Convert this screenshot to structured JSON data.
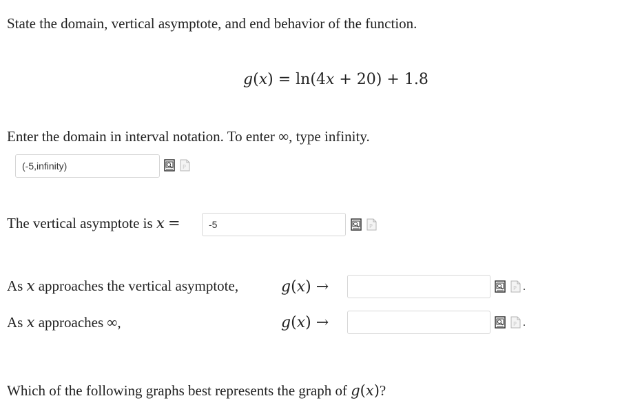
{
  "question": {
    "prompt": "State the domain, vertical asymptote, and end behavior of the function.",
    "function": {
      "lhs_name": "g",
      "lhs_var": "x",
      "rhs_ln": "ln",
      "rhs_inner_coef": "4",
      "rhs_inner_var": "x",
      "rhs_inner_const": "20",
      "rhs_add": "1.8"
    }
  },
  "domain_part": {
    "label": "Enter the domain in interval notation. To enter ∞, type infinity.",
    "value": "(-5,infinity)"
  },
  "asymptote_part": {
    "label_prefix": "The vertical asymptote is",
    "var": "x",
    "equals": "=",
    "value": "-5"
  },
  "end_behavior": {
    "row1_label_a": "As",
    "row1_var": "x",
    "row1_label_b": "approaches the vertical asymptote,",
    "row2_label_a": "As",
    "row2_var": "x",
    "row2_label_b": "approaches ∞,",
    "lhs": "g",
    "lhs_var": "x",
    "arrow": "→",
    "row1_value": "",
    "row2_value": "",
    "period": "."
  },
  "graph_question": {
    "text": "Which of the following graphs best represents the graph of",
    "fn": "g",
    "var": "x",
    "end": "?"
  },
  "icons": [
    "preview-icon",
    "help-icon"
  ]
}
